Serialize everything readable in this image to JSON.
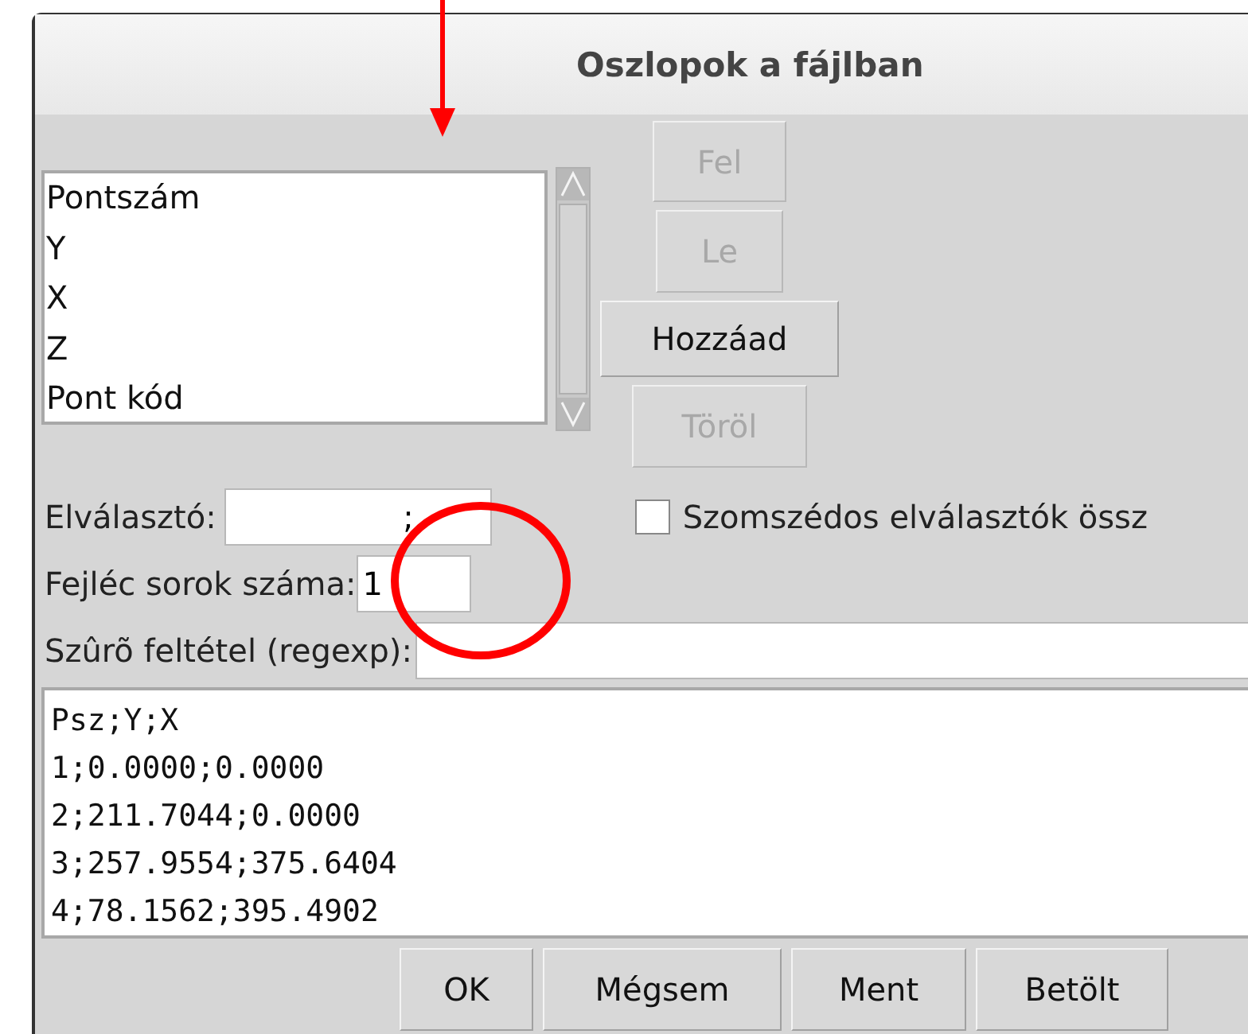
{
  "window": {
    "title": "Oszlopok a fájlban"
  },
  "columns_list": {
    "items": [
      "Pontszám",
      "Y",
      "X",
      "Z",
      "Pont kód"
    ]
  },
  "list_buttons": [
    {
      "label": "Fel",
      "disabled": true
    },
    {
      "label": "Le",
      "disabled": true
    },
    {
      "label": "Hozzáad",
      "disabled": false
    },
    {
      "label": "Töröl",
      "disabled": true
    }
  ],
  "separator": {
    "label": "Elválasztó:",
    "value": ";"
  },
  "merge_adjacent": {
    "label": "Szomszédos elválasztók össz",
    "checked": false
  },
  "header_rows": {
    "label": "Fejléc sorok száma:",
    "value": "1"
  },
  "filter": {
    "label": "Szûrõ feltétel (regexp):"
  },
  "preview": {
    "lines": [
      "Psz;Y;X",
      "1;0.0000;0.0000",
      "2;211.7044;0.0000",
      "3;257.9554;375.6404",
      "4;78.1562;395.4902"
    ]
  },
  "dialog_buttons": [
    {
      "label": "OK"
    },
    {
      "label": "Mégsem"
    },
    {
      "label": "Ment"
    },
    {
      "label": "Betölt"
    }
  ]
}
